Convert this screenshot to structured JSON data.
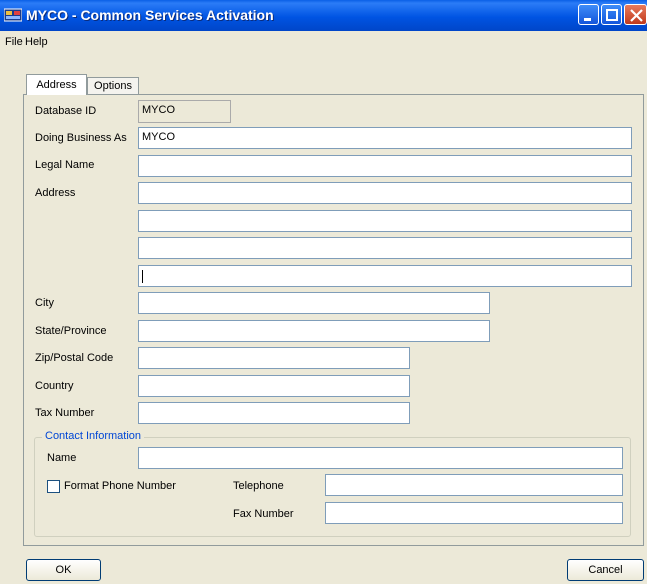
{
  "window": {
    "title": "MYCO - Common Services Activation"
  },
  "menu": [
    "File",
    "Help"
  ],
  "tabs": [
    {
      "label": "Address",
      "active": true
    },
    {
      "label": "Options",
      "active": false
    }
  ],
  "form": {
    "database_id": {
      "label": "Database ID",
      "value": "MYCO"
    },
    "doing_business_as": {
      "label": "Doing Business As",
      "value": "MYCO"
    },
    "legal_name": {
      "label": "Legal Name",
      "value": ""
    },
    "address": {
      "label": "Address",
      "lines": [
        "",
        "",
        "",
        ""
      ]
    },
    "city": {
      "label": "City",
      "value": ""
    },
    "state": {
      "label": "State/Province",
      "value": ""
    },
    "zip": {
      "label": "Zip/Postal Code",
      "value": ""
    },
    "country": {
      "label": "Country",
      "value": ""
    },
    "tax_number": {
      "label": "Tax Number",
      "value": ""
    }
  },
  "contact": {
    "title": "Contact Information",
    "name": {
      "label": "Name",
      "value": ""
    },
    "format_phone": {
      "label": "Format Phone Number",
      "checked": false
    },
    "telephone": {
      "label": "Telephone",
      "value": ""
    },
    "fax": {
      "label": "Fax Number",
      "value": ""
    }
  },
  "buttons": {
    "ok": "OK",
    "cancel": "Cancel"
  },
  "colors": {
    "titlebar": "#0054e3",
    "dialog_bg": "#ece9d8",
    "group_title": "#0046d5",
    "close_button": "#c0391b"
  }
}
